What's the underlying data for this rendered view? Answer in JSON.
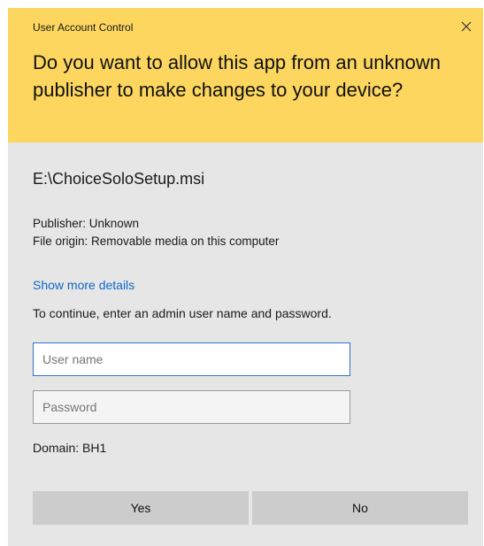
{
  "window": {
    "title": "User Account Control",
    "close_icon": "close-icon"
  },
  "header": {
    "question": "Do you want to allow this app from an unknown publisher to make changes to your device?"
  },
  "app": {
    "file_path": "E:\\ChoiceSoloSetup.msi",
    "publisher": "Publisher: Unknown",
    "file_origin": "File origin: Removable media on this computer"
  },
  "details_link": "Show more details",
  "credentials": {
    "instruction": "To continue, enter an admin user name and password.",
    "username_placeholder": "User name",
    "username_value": "",
    "password_placeholder": "Password",
    "password_value": "",
    "domain": "Domain: BH1"
  },
  "buttons": {
    "yes": "Yes",
    "no": "No"
  },
  "colors": {
    "header_bg": "#fcd65e",
    "body_bg": "#e6e6e6",
    "link": "#0f68c9",
    "focus_border": "#2f74c4",
    "button_bg": "#cccccc"
  }
}
